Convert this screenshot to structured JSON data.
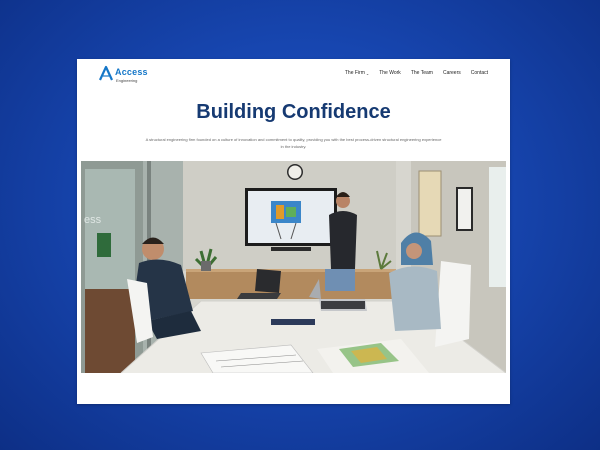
{
  "logo": {
    "name": "Access",
    "subtitle": "Engineering"
  },
  "nav": {
    "items": [
      {
        "label": "The Firm",
        "has_dropdown": true
      },
      {
        "label": "The Work"
      },
      {
        "label": "The Team"
      },
      {
        "label": "Careers"
      },
      {
        "label": "Contact"
      }
    ]
  },
  "hero": {
    "title": "Building Confidence",
    "subtitle": "A structural engineering firm founded on a culture of innovation and commitment to quality, providing you with the best process-driven structural engineering experience in the industry."
  },
  "photo": {
    "wall_text": "ess"
  },
  "colors": {
    "background": "#1746b0",
    "brand": "#1577c8",
    "title": "#163a72"
  }
}
